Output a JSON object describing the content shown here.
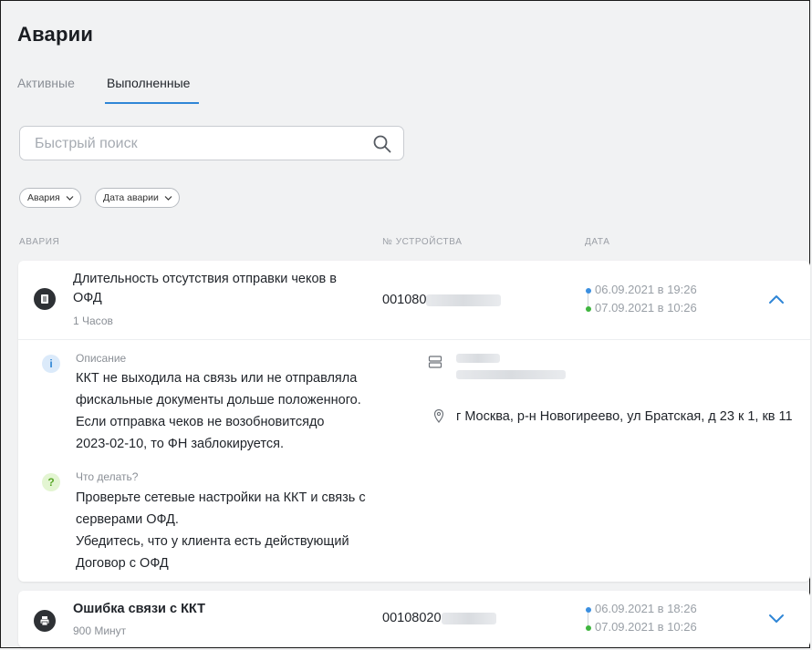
{
  "page": {
    "title": "Аварии"
  },
  "tabs": [
    {
      "label": "Активные",
      "active": false
    },
    {
      "label": "Выполненные",
      "active": true
    }
  ],
  "search": {
    "placeholder": "Быстрый поиск",
    "value": ""
  },
  "filters": [
    {
      "label": "Авария"
    },
    {
      "label": "Дата аварии"
    }
  ],
  "columns": {
    "alarm": "АВАРИЯ",
    "device": "№ УСТРОЙСТВА",
    "date": "ДАТА"
  },
  "alarms": [
    {
      "title": "Длительность отсутствия отправки чеков в ОФД",
      "duration": "1 Часов",
      "device_prefix": "001080",
      "date_start": "06.09.2021 в 19:26",
      "date_end": "07.09.2021 в 10:26",
      "expanded": true,
      "description_label": "Описание",
      "description_text": "ККТ не выходила на связь или не отправляла\nфискальные документы дольше положенного.\nЕсли отправка чеков не возобновитсядо\n2023-02-10, то ФН заблокируется.",
      "todo_label": "Что делать?",
      "todo_text": "Проверьте сетевые настройки на ККТ и связь с\nсерверами ОФД.\nУбедитесь, что у клиента есть действующий\nДоговор с ОФД",
      "address": "г Москва, р-н Новогиреево, ул Братская, д 23 к 1, кв 11"
    },
    {
      "title": "Ошибка связи с ККТ",
      "duration": "900 Минут",
      "device_prefix": "00108020",
      "date_start": "06.09.2021 в 18:26",
      "date_end": "07.09.2021 в 10:26",
      "expanded": false
    }
  ],
  "colors": {
    "accent": "#2f86d6",
    "start_dot": "#3b8fe0",
    "end_dot": "#3fb53f",
    "info_bg": "#dbeafa",
    "help_bg": "#e3f5d2"
  }
}
